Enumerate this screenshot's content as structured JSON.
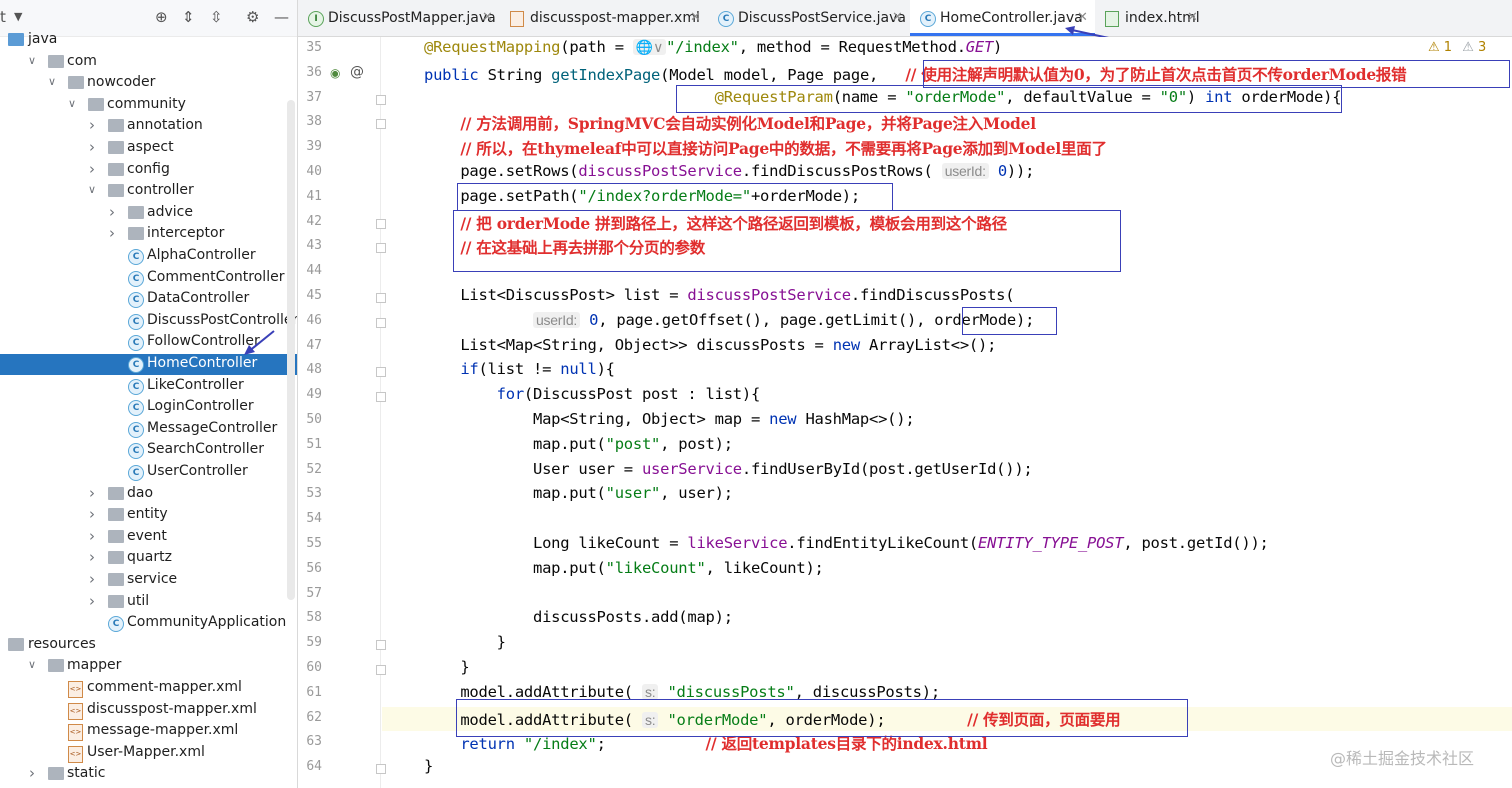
{
  "project_panel": {
    "header_label": "t",
    "tree": [
      {
        "label": "java",
        "depth": 0,
        "expanded": true,
        "icon": "folder-blue"
      },
      {
        "label": "com",
        "depth": 1,
        "expanded": true,
        "icon": "folder"
      },
      {
        "label": "nowcoder",
        "depth": 2,
        "expanded": true,
        "icon": "folder"
      },
      {
        "label": "community",
        "depth": 3,
        "expanded": true,
        "icon": "folder"
      },
      {
        "label": "annotation",
        "depth": 4,
        "expanded": false,
        "icon": "folder"
      },
      {
        "label": "aspect",
        "depth": 4,
        "expanded": false,
        "icon": "folder"
      },
      {
        "label": "config",
        "depth": 4,
        "expanded": false,
        "icon": "folder"
      },
      {
        "label": "controller",
        "depth": 4,
        "expanded": true,
        "icon": "folder"
      },
      {
        "label": "advice",
        "depth": 5,
        "expanded": false,
        "icon": "folder"
      },
      {
        "label": "interceptor",
        "depth": 5,
        "expanded": false,
        "icon": "folder"
      },
      {
        "label": "AlphaController",
        "depth": 5,
        "icon": "class"
      },
      {
        "label": "CommentController",
        "depth": 5,
        "icon": "class"
      },
      {
        "label": "DataController",
        "depth": 5,
        "icon": "class"
      },
      {
        "label": "DiscussPostController",
        "depth": 5,
        "icon": "class"
      },
      {
        "label": "FollowController",
        "depth": 5,
        "icon": "class"
      },
      {
        "label": "HomeController",
        "depth": 5,
        "icon": "class",
        "selected": true
      },
      {
        "label": "LikeController",
        "depth": 5,
        "icon": "class"
      },
      {
        "label": "LoginController",
        "depth": 5,
        "icon": "class"
      },
      {
        "label": "MessageController",
        "depth": 5,
        "icon": "class"
      },
      {
        "label": "SearchController",
        "depth": 5,
        "icon": "class"
      },
      {
        "label": "UserController",
        "depth": 5,
        "icon": "class"
      },
      {
        "label": "dao",
        "depth": 4,
        "expanded": false,
        "icon": "folder"
      },
      {
        "label": "entity",
        "depth": 4,
        "expanded": false,
        "icon": "folder"
      },
      {
        "label": "event",
        "depth": 4,
        "expanded": false,
        "icon": "folder"
      },
      {
        "label": "quartz",
        "depth": 4,
        "expanded": false,
        "icon": "folder"
      },
      {
        "label": "service",
        "depth": 4,
        "expanded": false,
        "icon": "folder"
      },
      {
        "label": "util",
        "depth": 4,
        "expanded": false,
        "icon": "folder"
      },
      {
        "label": "CommunityApplication",
        "depth": 4,
        "icon": "class"
      },
      {
        "label": "resources",
        "depth": 0,
        "icon": "folder"
      },
      {
        "label": "mapper",
        "depth": 1,
        "expanded": true,
        "icon": "folder"
      },
      {
        "label": "comment-mapper.xml",
        "depth": 2,
        "icon": "xml"
      },
      {
        "label": "discusspost-mapper.xml",
        "depth": 2,
        "icon": "xml"
      },
      {
        "label": "message-mapper.xml",
        "depth": 2,
        "icon": "xml"
      },
      {
        "label": "User-Mapper.xml",
        "depth": 2,
        "icon": "xml"
      },
      {
        "label": "static",
        "depth": 1,
        "expanded": false,
        "icon": "folder"
      }
    ]
  },
  "tabs": [
    {
      "label": "DiscussPostMapper.java",
      "icon": "interface",
      "active": false
    },
    {
      "label": "discusspost-mapper.xml",
      "icon": "xml",
      "active": false
    },
    {
      "label": "DiscussPostService.java",
      "icon": "class",
      "active": false
    },
    {
      "label": "HomeController.java",
      "icon": "class",
      "active": true
    },
    {
      "label": "index.html",
      "icon": "html",
      "active": false
    }
  ],
  "inspections": {
    "warnings": "1",
    "weak_warnings": "3"
  },
  "editor": {
    "line_numbers": [
      "35",
      "36",
      "37",
      "38",
      "39",
      "40",
      "41",
      "42",
      "43",
      "44",
      "45",
      "46",
      "47",
      "48",
      "49",
      "50",
      "51",
      "52",
      "53",
      "54",
      "55",
      "56",
      "57",
      "58",
      "59",
      "60",
      "61",
      "62",
      "63",
      "64"
    ],
    "lines": [
      [
        [
          "ann",
          "@RequestMapping"
        ],
        [
          "",
          "(path = "
        ],
        [
          "hint",
          "🌐∨"
        ],
        [
          "str",
          "\"/index\""
        ],
        [
          "",
          ", method = RequestMethod."
        ],
        [
          "ital",
          "GET"
        ],
        [
          "",
          ")"
        ]
      ],
      [
        [
          "kw",
          "public "
        ],
        [
          "",
          "String "
        ],
        [
          "meth",
          "getIndexPage"
        ],
        [
          "",
          "(Model model, Page page,   "
        ],
        [
          "cmt",
          "// 使用注解声明默认值为0，为了防止首次点击首页不传orderMode报错"
        ]
      ],
      [
        [
          "",
          "                                "
        ],
        [
          "ann",
          "@RequestParam"
        ],
        [
          "",
          "(name = "
        ],
        [
          "str",
          "\"orderMode\""
        ],
        [
          "",
          ", defaultValue = "
        ],
        [
          "str",
          "\"0\""
        ],
        [
          "",
          ") "
        ],
        [
          "kw",
          "int "
        ],
        [
          "",
          "orderMode){"
        ]
      ],
      [
        [
          "",
          "    "
        ],
        [
          "cmt",
          "// 方法调用前，SpringMVC会自动实例化Model和Page，并将Page注入Model"
        ]
      ],
      [
        [
          "",
          "    "
        ],
        [
          "cmt",
          "// 所以，在thymeleaf中可以直接访问Page中的数据，不需要再将Page添加到Model里面了"
        ]
      ],
      [
        [
          "",
          "    page.setRows("
        ],
        [
          "fld",
          "discussPostService"
        ],
        [
          "",
          ".findDiscussPostRows( "
        ],
        [
          "hint",
          "userId:"
        ],
        [
          "kw",
          " 0"
        ],
        [
          "",
          "));"
        ]
      ],
      [
        [
          "",
          "    page.setPath("
        ],
        [
          "str",
          "\"/index?orderMode=\""
        ],
        [
          "",
          "+orderMode);"
        ]
      ],
      [
        [
          "",
          "    "
        ],
        [
          "cmt",
          "// 把 orderMode 拼到路径上，这样这个路径返回到模板，模板会用到这个路径"
        ]
      ],
      [
        [
          "",
          "    "
        ],
        [
          "cmt",
          "// 在这基础上再去拼那个分页的参数"
        ]
      ],
      [
        [
          "",
          ""
        ]
      ],
      [
        [
          "",
          "    List<DiscussPost> list = "
        ],
        [
          "fld",
          "discussPostService"
        ],
        [
          "",
          ".findDiscussPosts("
        ]
      ],
      [
        [
          "",
          "            "
        ],
        [
          "hint",
          "userId:"
        ],
        [
          "kw",
          " 0"
        ],
        [
          "",
          ", page.getOffset(), page.getLimit(), orderMode);"
        ]
      ],
      [
        [
          "",
          "    List<Map<String, Object>> discussPosts = "
        ],
        [
          "kw",
          "new "
        ],
        [
          "",
          "ArrayList<>();"
        ]
      ],
      [
        [
          "",
          "    "
        ],
        [
          "kw",
          "if"
        ],
        [
          "",
          "(list != "
        ],
        [
          "kw",
          "null"
        ],
        [
          "",
          "){"
        ]
      ],
      [
        [
          "",
          "        "
        ],
        [
          "kw",
          "for"
        ],
        [
          "",
          "(DiscussPost post : list){"
        ]
      ],
      [
        [
          "",
          "            Map<String, Object> map = "
        ],
        [
          "kw",
          "new "
        ],
        [
          "",
          "HashMap<>();"
        ]
      ],
      [
        [
          "",
          "            map.put("
        ],
        [
          "str",
          "\"post\""
        ],
        [
          "",
          ", post);"
        ]
      ],
      [
        [
          "",
          "            User user = "
        ],
        [
          "fld",
          "userService"
        ],
        [
          "",
          ".findUserById(post.getUserId());"
        ]
      ],
      [
        [
          "",
          "            map.put("
        ],
        [
          "str",
          "\"user\""
        ],
        [
          "",
          ", user);"
        ]
      ],
      [
        [
          "",
          ""
        ]
      ],
      [
        [
          "",
          "            Long likeCount = "
        ],
        [
          "fld",
          "likeService"
        ],
        [
          "",
          ".findEntityLikeCount("
        ],
        [
          "ital",
          "ENTITY_TYPE_POST"
        ],
        [
          "",
          ", post.getId());"
        ]
      ],
      [
        [
          "",
          "            map.put("
        ],
        [
          "str",
          "\"likeCount\""
        ],
        [
          "",
          ", likeCount);"
        ]
      ],
      [
        [
          "",
          ""
        ]
      ],
      [
        [
          "",
          "            discussPosts.add(map);"
        ]
      ],
      [
        [
          "",
          "        }"
        ]
      ],
      [
        [
          "",
          "    }"
        ]
      ],
      [
        [
          "",
          "    model.addAttribute( "
        ],
        [
          "hint",
          "s:"
        ],
        [
          "str",
          " \"discussPosts\""
        ],
        [
          "",
          ", discussPosts);"
        ]
      ],
      [
        [
          "",
          "    model.addAttribute( "
        ],
        [
          "hint",
          "s:"
        ],
        [
          "str",
          " \"orderMode\""
        ],
        [
          "",
          ", orderMode);         "
        ],
        [
          "cmt",
          "// 传到页面，页面要用"
        ]
      ],
      [
        [
          "",
          "    "
        ],
        [
          "kw",
          "return "
        ],
        [
          "str",
          "\"/index\""
        ],
        [
          "",
          ";           "
        ],
        [
          "cmt",
          "// 返回templates目录下的index.html"
        ]
      ],
      [
        [
          "",
          "}"
        ]
      ]
    ]
  },
  "watermark": "@稀土掘金技术社区"
}
